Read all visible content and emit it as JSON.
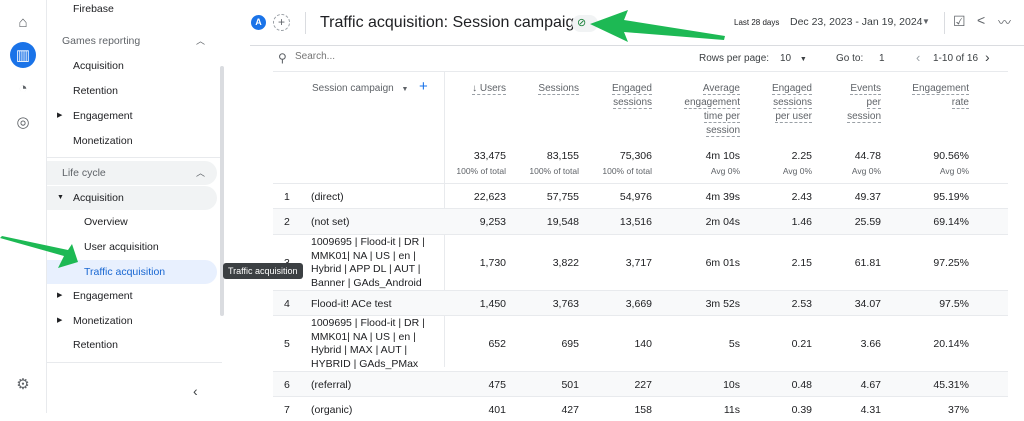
{
  "sidebar": {
    "firebase": "Firebase",
    "games_reporting": "Games reporting",
    "games_items": [
      "Acquisition",
      "Retention",
      "Engagement",
      "Monetization"
    ],
    "life_cycle": "Life cycle",
    "acquisition": "Acquisition",
    "acq_items": [
      "Overview",
      "User acquisition",
      "Traffic acquisition"
    ],
    "lc_items": [
      "Engagement",
      "Monetization",
      "Retention"
    ],
    "tooltip": "Traffic acquisition",
    "collapse_icon": "chevron-left-icon"
  },
  "header": {
    "avatar": "A",
    "title": "Traffic acquisition: Session campaign",
    "date_label": "Last 28 days",
    "date_range": "Dec 23, 2023 - Jan 19, 2024"
  },
  "toolbar": {
    "search_placeholder": "Search...",
    "rows_per_page_label": "Rows per page:",
    "rows_per_page": "10",
    "goto_label": "Go to:",
    "goto": "1",
    "pagination": "1-10 of 16"
  },
  "table": {
    "dimension": "Session campaign",
    "columns": [
      [
        "↓ Users"
      ],
      [
        "Sessions"
      ],
      [
        "Engaged",
        "sessions"
      ],
      [
        "Average",
        "engagement",
        "time per",
        "session"
      ],
      [
        "Engaged",
        "sessions",
        "per user"
      ],
      [
        "Events",
        "per",
        "session"
      ],
      [
        "Engagement",
        "rate"
      ]
    ],
    "totals": [
      "33,475",
      "83,155",
      "75,306",
      "4m 10s",
      "2.25",
      "44.78",
      "90.56%"
    ],
    "totals_sub": [
      "100% of total",
      "100% of total",
      "100% of total",
      "Avg 0%",
      "Avg 0%",
      "Avg 0%",
      "Avg 0%"
    ],
    "rows": [
      {
        "n": "1",
        "name": [
          "(direct)"
        ],
        "v": [
          "22,623",
          "57,755",
          "54,976",
          "4m 39s",
          "2.43",
          "49.37",
          "95.19%"
        ]
      },
      {
        "n": "2",
        "name": [
          "(not set)"
        ],
        "v": [
          "9,253",
          "19,548",
          "13,516",
          "2m 04s",
          "1.46",
          "25.59",
          "69.14%"
        ]
      },
      {
        "n": "3",
        "name": [
          "1009695 | Flood-it | DR |",
          "MMK01| NA | US | en |",
          "Hybrid | APP DL | AUT |",
          "Banner | GAds_Android"
        ],
        "v": [
          "1,730",
          "3,822",
          "3,717",
          "6m 01s",
          "2.15",
          "61.81",
          "97.25%"
        ]
      },
      {
        "n": "4",
        "name": [
          "Flood-it! ACe test"
        ],
        "v": [
          "1,450",
          "3,763",
          "3,669",
          "3m 52s",
          "2.53",
          "34.07",
          "97.5%"
        ]
      },
      {
        "n": "5",
        "name": [
          "1009695 | Flood-it | DR |",
          "MMK01| NA | US | en |",
          "Hybrid | MAX | AUT |",
          "HYBRID | GAds_PMax"
        ],
        "v": [
          "652",
          "695",
          "140",
          "5s",
          "0.21",
          "3.66",
          "20.14%"
        ]
      },
      {
        "n": "6",
        "name": [
          "(referral)"
        ],
        "v": [
          "475",
          "501",
          "227",
          "10s",
          "0.48",
          "4.67",
          "45.31%"
        ]
      },
      {
        "n": "7",
        "name": [
          "(organic)"
        ],
        "v": [
          "401",
          "427",
          "158",
          "11s",
          "0.39",
          "4.31",
          "37%"
        ]
      }
    ]
  },
  "colors": {
    "accent": "#1a73e8",
    "arrow": "#1db954",
    "success": "#188038"
  }
}
